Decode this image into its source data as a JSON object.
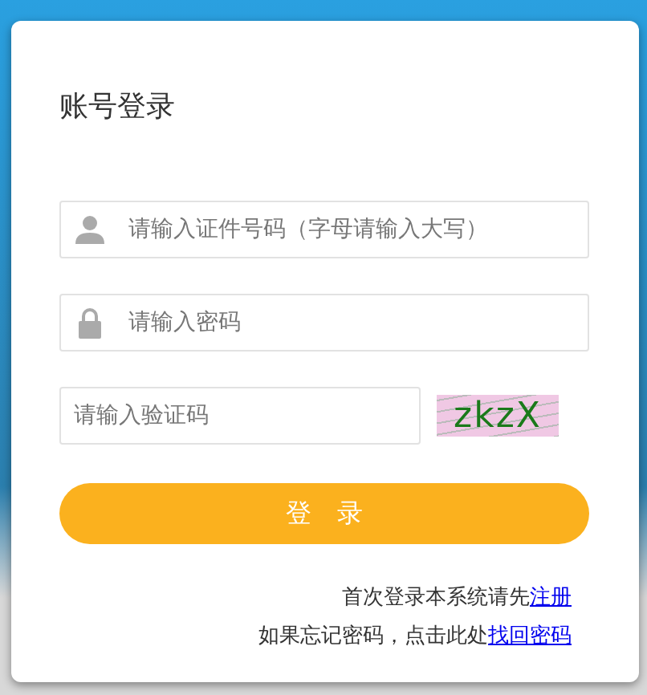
{
  "title": "账号登录",
  "fields": [
    {
      "kind": "user",
      "placeholder": "请输入证件号码（字母请输入大写）"
    },
    {
      "kind": "lock",
      "placeholder": "请输入密码"
    }
  ],
  "captcha": {
    "placeholder": "请输入验证码",
    "code": "zkzX"
  },
  "button": "登　录",
  "help": [
    {
      "text": "首次登录本系统请先",
      "link": "注册"
    },
    {
      "text": "如果忘记密码，点击此处",
      "link": "找回密码"
    }
  ]
}
